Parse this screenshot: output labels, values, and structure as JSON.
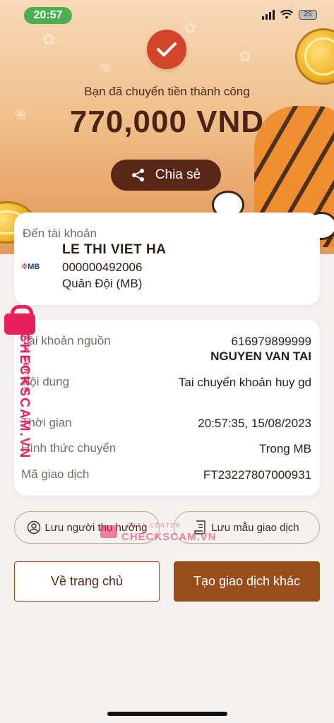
{
  "status_bar": {
    "time": "20:57",
    "battery": "25"
  },
  "header": {
    "success_message": "Bạn đã chuyển tiền thành công",
    "amount": "770,000 VND",
    "share_label": "Chia sẻ"
  },
  "recipient": {
    "label": "Đến tài khoản",
    "bank_logo": "MB",
    "name": "LE THI VIET HA",
    "account_number": "000000492006",
    "bank_name": "Quân Đội (MB)"
  },
  "details": {
    "source_label": "Tài khoản nguồn",
    "source_account": "616979899999",
    "source_name": "NGUYEN VAN TAI",
    "content_label": "Nội dung",
    "content_value": "Tai chuyển khoản huy gd",
    "time_label": "Thời gian",
    "time_value": "20:57:35, 15/08/2023",
    "method_label": "Hình thức chuyển",
    "method_value": "Trong MB",
    "txn_label": "Mã giao dịch",
    "txn_value": "FT23227807000931"
  },
  "actions": {
    "save_beneficiary": "Lưu người thụ hưởng",
    "save_template": "Lưu mẫu giao dịch",
    "home": "Về trang chủ",
    "new_transaction": "Tạo giao dịch khác"
  },
  "watermark": {
    "brand": "CHECKSCAM.VN",
    "sub": "DATA CENTER"
  },
  "icons": [
    "check-icon",
    "share-icon",
    "user-circle-icon",
    "document-icon",
    "signal-icon",
    "wifi-icon",
    "battery-icon"
  ],
  "colors": {
    "primary": "#9a4d1c",
    "success_check": "#d4442b",
    "share_bg": "#5a2617"
  }
}
